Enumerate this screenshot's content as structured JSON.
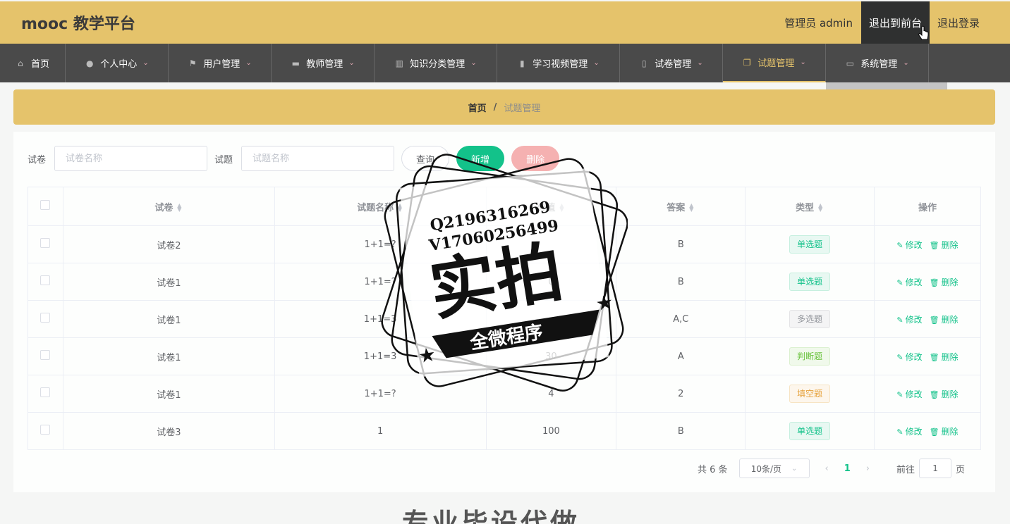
{
  "header": {
    "brand": "mooc 教学平台",
    "user": "管理员 admin",
    "front": "退出到前台",
    "logout": "退出登录"
  },
  "nav": [
    {
      "label": "首页",
      "icon": "home-icon",
      "w": 93
    },
    {
      "label": "个人中心",
      "icon": "user-icon",
      "w": 146
    },
    {
      "label": "用户管理",
      "icon": "flag-icon",
      "w": 146
    },
    {
      "label": "教师管理",
      "icon": "teacher-icon",
      "w": 146
    },
    {
      "label": "知识分类管理",
      "icon": "category-icon",
      "w": 174
    },
    {
      "label": "学习视频管理",
      "icon": "chart-icon",
      "w": 174
    },
    {
      "label": "试卷管理",
      "icon": "paper-icon",
      "w": 146
    },
    {
      "label": "试题管理",
      "icon": "copy-icon",
      "w": 146
    },
    {
      "label": "系统管理",
      "icon": "system-icon",
      "w": 146
    }
  ],
  "breadcrumb": {
    "home": "首页",
    "sep": "/",
    "current": "试题管理"
  },
  "search": {
    "paper_label": "试卷",
    "paper_placeholder": "试卷名称",
    "question_label": "试题",
    "question_placeholder": "试题名称",
    "query": "查询",
    "add": "新增",
    "delete": "删除"
  },
  "table": {
    "headers": [
      "试卷",
      "试题名称",
      "分值",
      "答案",
      "类型",
      "操作"
    ],
    "rows": [
      {
        "paper": "试卷2",
        "name": "1+1=?",
        "score": "",
        "answer": "B",
        "type": "单选题",
        "kind": "single"
      },
      {
        "paper": "试卷1",
        "name": "1+1=?",
        "score": "0",
        "answer": "B",
        "type": "单选题",
        "kind": "single"
      },
      {
        "paper": "试卷1",
        "name": "1+1=3",
        "score": "",
        "answer": "A,C",
        "type": "多选题",
        "kind": "multi"
      },
      {
        "paper": "试卷1",
        "name": "1+1=3",
        "score": "30",
        "answer": "A",
        "type": "判断题",
        "kind": "judge"
      },
      {
        "paper": "试卷1",
        "name": "1+1=?",
        "score": "4",
        "answer": "2",
        "type": "填空题",
        "kind": "fill"
      },
      {
        "paper": "试卷3",
        "name": "1",
        "score": "100",
        "answer": "B",
        "type": "单选题",
        "kind": "single"
      }
    ],
    "edit": "修改",
    "remove": "删除"
  },
  "pager": {
    "total": "共 6 条",
    "size": "10条/页",
    "current": "1",
    "goto": "前往",
    "goto_value": "1",
    "page_unit": "页"
  },
  "stamp": {
    "line1": "Q2196316269",
    "line2": "V17060256499",
    "big": "实拍",
    "banner": "全微程序"
  },
  "footer": "专业毕设代做",
  "colors": {
    "accent": "#e5c36b",
    "nav": "#4a4a4a",
    "primary": "#13c28a"
  }
}
